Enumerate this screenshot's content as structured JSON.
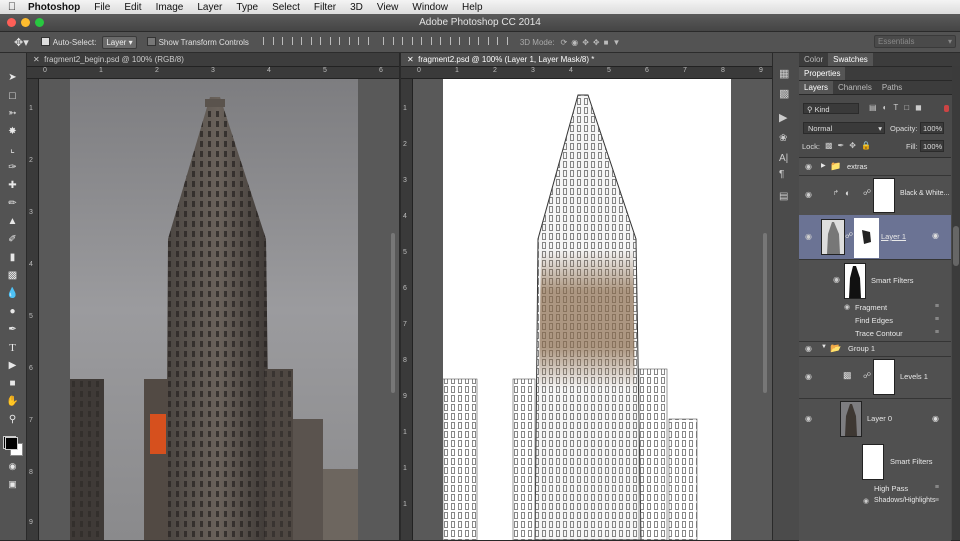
{
  "menubar": {
    "apple_icon": "apple-icon",
    "items": [
      "Photoshop",
      "File",
      "Edit",
      "Image",
      "Layer",
      "Type",
      "Select",
      "Filter",
      "3D",
      "View",
      "Window",
      "Help"
    ]
  },
  "window": {
    "title": "Adobe Photoshop CC 2014",
    "traffic_colors": [
      "#fe5f57",
      "#febc2e",
      "#28c840"
    ]
  },
  "options": {
    "autoselect_label": "Auto-Select:",
    "autoselect_value": "Layer",
    "transform_label": "Show Transform Controls",
    "mode3d_label": "3D Mode:",
    "workspace": "Essentials"
  },
  "tools": [
    "move-tool",
    "marquee-tool",
    "lasso-tool",
    "quick-select-tool",
    "crop-tool",
    "eyedropper-tool",
    "healing-tool",
    "brush-tool",
    "stamp-tool",
    "history-brush-tool",
    "eraser-tool",
    "gradient-tool",
    "blur-tool",
    "dodge-tool",
    "pen-tool",
    "type-tool",
    "path-select-tool",
    "shape-tool",
    "hand-tool",
    "zoom-tool"
  ],
  "documents": [
    {
      "tab": "fragment2_begin.psd @ 100% (RGB/8)",
      "ruler_h": [
        "0",
        "1",
        "2",
        "3",
        "4",
        "5",
        "6"
      ],
      "ruler_v": [
        "1",
        "2",
        "3",
        "4",
        "5",
        "6",
        "7",
        "8",
        "9",
        "1",
        "0",
        "1",
        "1",
        "1",
        "2",
        "1",
        "3"
      ]
    },
    {
      "tab": "fragment2.psd @ 100% (Layer 1, Layer Mask/8) *",
      "ruler_h": [
        "0",
        "1",
        "2",
        "3",
        "4",
        "5",
        "6",
        "7",
        "8",
        "9"
      ],
      "ruler_v": [
        "1",
        "2",
        "3",
        "4",
        "5",
        "6",
        "7",
        "8",
        "9",
        "1",
        "0",
        "1",
        "1",
        "1",
        "2",
        "1",
        "3"
      ]
    }
  ],
  "panels": {
    "top_tabs": [
      "Color",
      "Swatches"
    ],
    "properties": "Properties",
    "layer_tabs": [
      "Layers",
      "Channels",
      "Paths"
    ],
    "kind": "Kind",
    "blend": "Normal",
    "opacity_label": "Opacity:",
    "opacity_value": "100%",
    "lock_label": "Lock:",
    "fill_label": "Fill:",
    "fill_value": "100%",
    "layers": {
      "extras": "extras",
      "bw": "Black & White...",
      "layer1": "Layer 1",
      "smart_filters_1": "Smart Filters",
      "fx1": [
        "Fragment",
        "Find Edges",
        "Trace Contour"
      ],
      "group1": "Group 1",
      "levels": "Levels 1",
      "layer0": "Layer 0",
      "smart_filters_2": "Smart Filters",
      "fx2": [
        "High Pass",
        "Shadows/Highlights"
      ]
    }
  }
}
